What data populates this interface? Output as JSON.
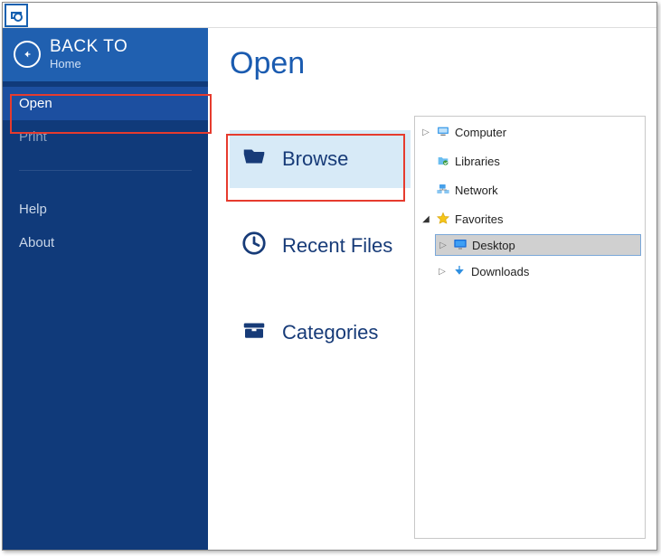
{
  "back": {
    "title": "BACK TO",
    "subtitle": "Home"
  },
  "sidebar": {
    "items": [
      {
        "label": "Open",
        "selected": true
      },
      {
        "label": "Print",
        "selected": false
      }
    ],
    "items2": [
      {
        "label": "Help"
      },
      {
        "label": "About"
      }
    ]
  },
  "page": {
    "title": "Open"
  },
  "actions": {
    "browse": "Browse",
    "recent": "Recent Files",
    "categories": "Categories"
  },
  "tree": {
    "computer": "Computer",
    "libraries": "Libraries",
    "network": "Network",
    "favorites": "Favorites",
    "desktop": "Desktop",
    "downloads": "Downloads"
  }
}
